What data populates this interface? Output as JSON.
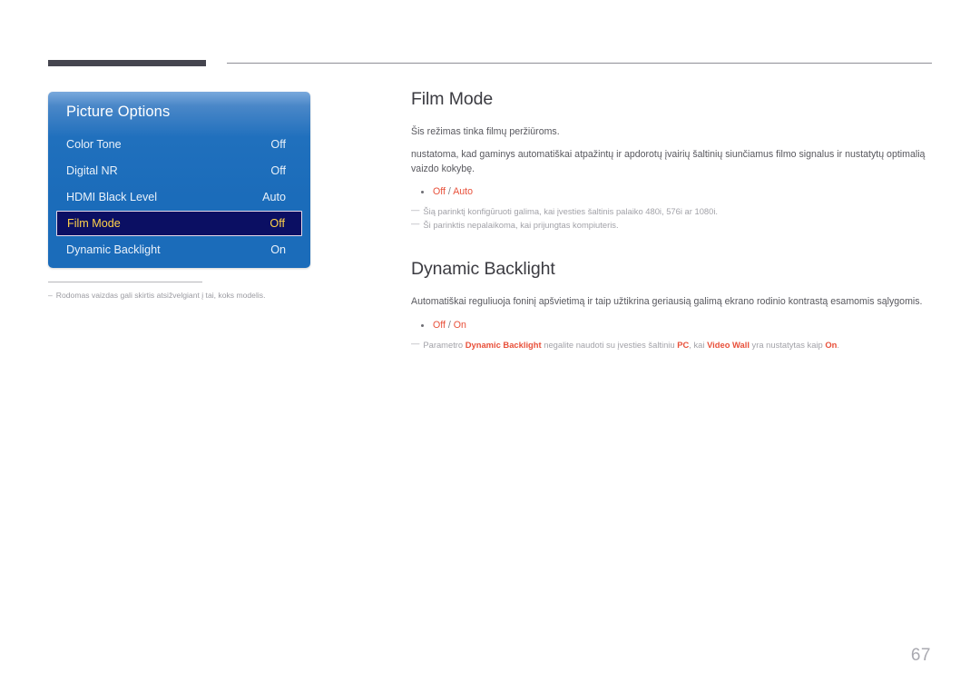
{
  "header": {
    "rule_thick_color": "#45454f",
    "rule_thin_color": "#8e8e96"
  },
  "osd": {
    "title": "Picture Options",
    "rows": [
      {
        "label": "Color Tone",
        "value": "Off",
        "selected": false
      },
      {
        "label": "Digital NR",
        "value": "Off",
        "selected": false
      },
      {
        "label": "HDMI Black Level",
        "value": "Auto",
        "selected": false
      },
      {
        "label": "Film Mode",
        "value": "Off",
        "selected": true
      },
      {
        "label": "Dynamic Backlight",
        "value": "On",
        "selected": false
      }
    ],
    "accent_selected": "#ffd24a",
    "panel_blue": "#1b6cba",
    "note": {
      "dash": "–",
      "text": "Rodomas vaizdas gali skirtis atsižvelgiant į tai, koks modelis."
    }
  },
  "content": {
    "sections": [
      {
        "title": "Film Mode",
        "paragraphs": [
          "Šis režimas tinka filmų peržiūroms.",
          "nustatoma, kad gaminys automatiškai atpažintų ir apdorotų įvairių šaltinių siunčiamus filmo signalus ir nustatytų optimalią vaizdo kokybę."
        ],
        "options": [
          {
            "first": "Off",
            "sep": " / ",
            "second": "Auto"
          }
        ],
        "notes": [
          {
            "dash": "—",
            "parts": [
              {
                "text": "Šią parinktį konfigūruoti galima, kai įvesties šaltinis palaiko 480i, 576i ar 1080i.",
                "bold": false
              }
            ]
          },
          {
            "dash": "—",
            "parts": [
              {
                "text": "Ši parinktis nepalaikoma, kai prijungtas kompiuteris.",
                "bold": false
              }
            ]
          }
        ]
      },
      {
        "title": "Dynamic Backlight",
        "paragraphs": [
          "Automatiškai reguliuoja foninį apšvietimą ir taip užtikrina geriausią galimą ekrano rodinio kontrastą esamomis sąlygomis."
        ],
        "options": [
          {
            "first": "Off",
            "sep": " / ",
            "second": "On"
          }
        ],
        "notes": [
          {
            "dash": "—",
            "parts": [
              {
                "text": "Parametro ",
                "bold": false
              },
              {
                "text": "Dynamic Backlight",
                "bold": true
              },
              {
                "text": " negalite naudoti su įvesties šaltiniu ",
                "bold": false
              },
              {
                "text": "PC",
                "bold": true
              },
              {
                "text": ", kai ",
                "bold": false
              },
              {
                "text": "Video Wall",
                "bold": true
              },
              {
                "text": " yra nustatytas kaip ",
                "bold": false
              },
              {
                "text": "On",
                "bold": true
              },
              {
                "text": ".",
                "bold": false
              }
            ]
          }
        ]
      }
    ],
    "accent_color": "#e8503a"
  },
  "page_number": "67"
}
